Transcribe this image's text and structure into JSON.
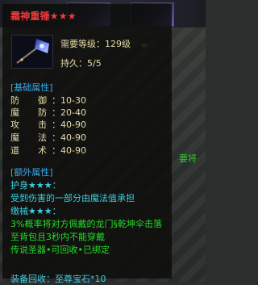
{
  "background": {
    "side_label": "要将"
  },
  "tooltip": {
    "title": "霜神重锤★★★",
    "item_icon": "hammer-weapon-icon",
    "required_level": "需要等级：129级",
    "durability": "持久：5/5",
    "basic_header": "[基础属性]",
    "stats": [
      {
        "k1": "防",
        "k2": "御",
        "value": "：10-30"
      },
      {
        "k1": "魔",
        "k2": "防",
        "value": "：20-40"
      },
      {
        "k1": "攻",
        "k2": "击",
        "value": "：40-90"
      },
      {
        "k1": "魔",
        "k2": "法",
        "value": "：40-90"
      },
      {
        "k1": "道",
        "k2": "术",
        "value": "：40-90"
      }
    ],
    "extra_header": "[额外属性]",
    "extra_lines": [
      {
        "text": "护身★★★：",
        "color": "cyan"
      },
      {
        "text": "受到伤害的一部分由魔法值承担",
        "color": "cyan"
      },
      {
        "text": "缴械★★★：",
        "color": "cyan"
      },
      {
        "text": "3%概率将对方佩戴的龙门§乾坤伞击落",
        "color": "green"
      },
      {
        "text": "至背包且3秒内不能穿戴",
        "color": "green"
      },
      {
        "text": "传说圣器•可回收•已绑定",
        "color": "green"
      }
    ],
    "recycle": "装备回收：至尊宝石*10"
  },
  "colors": {
    "title": "#f13a3a",
    "header": "#3ca9e8",
    "stat": "#e6dbaa",
    "cyan": "#3ccde3",
    "green": "#23de27"
  }
}
